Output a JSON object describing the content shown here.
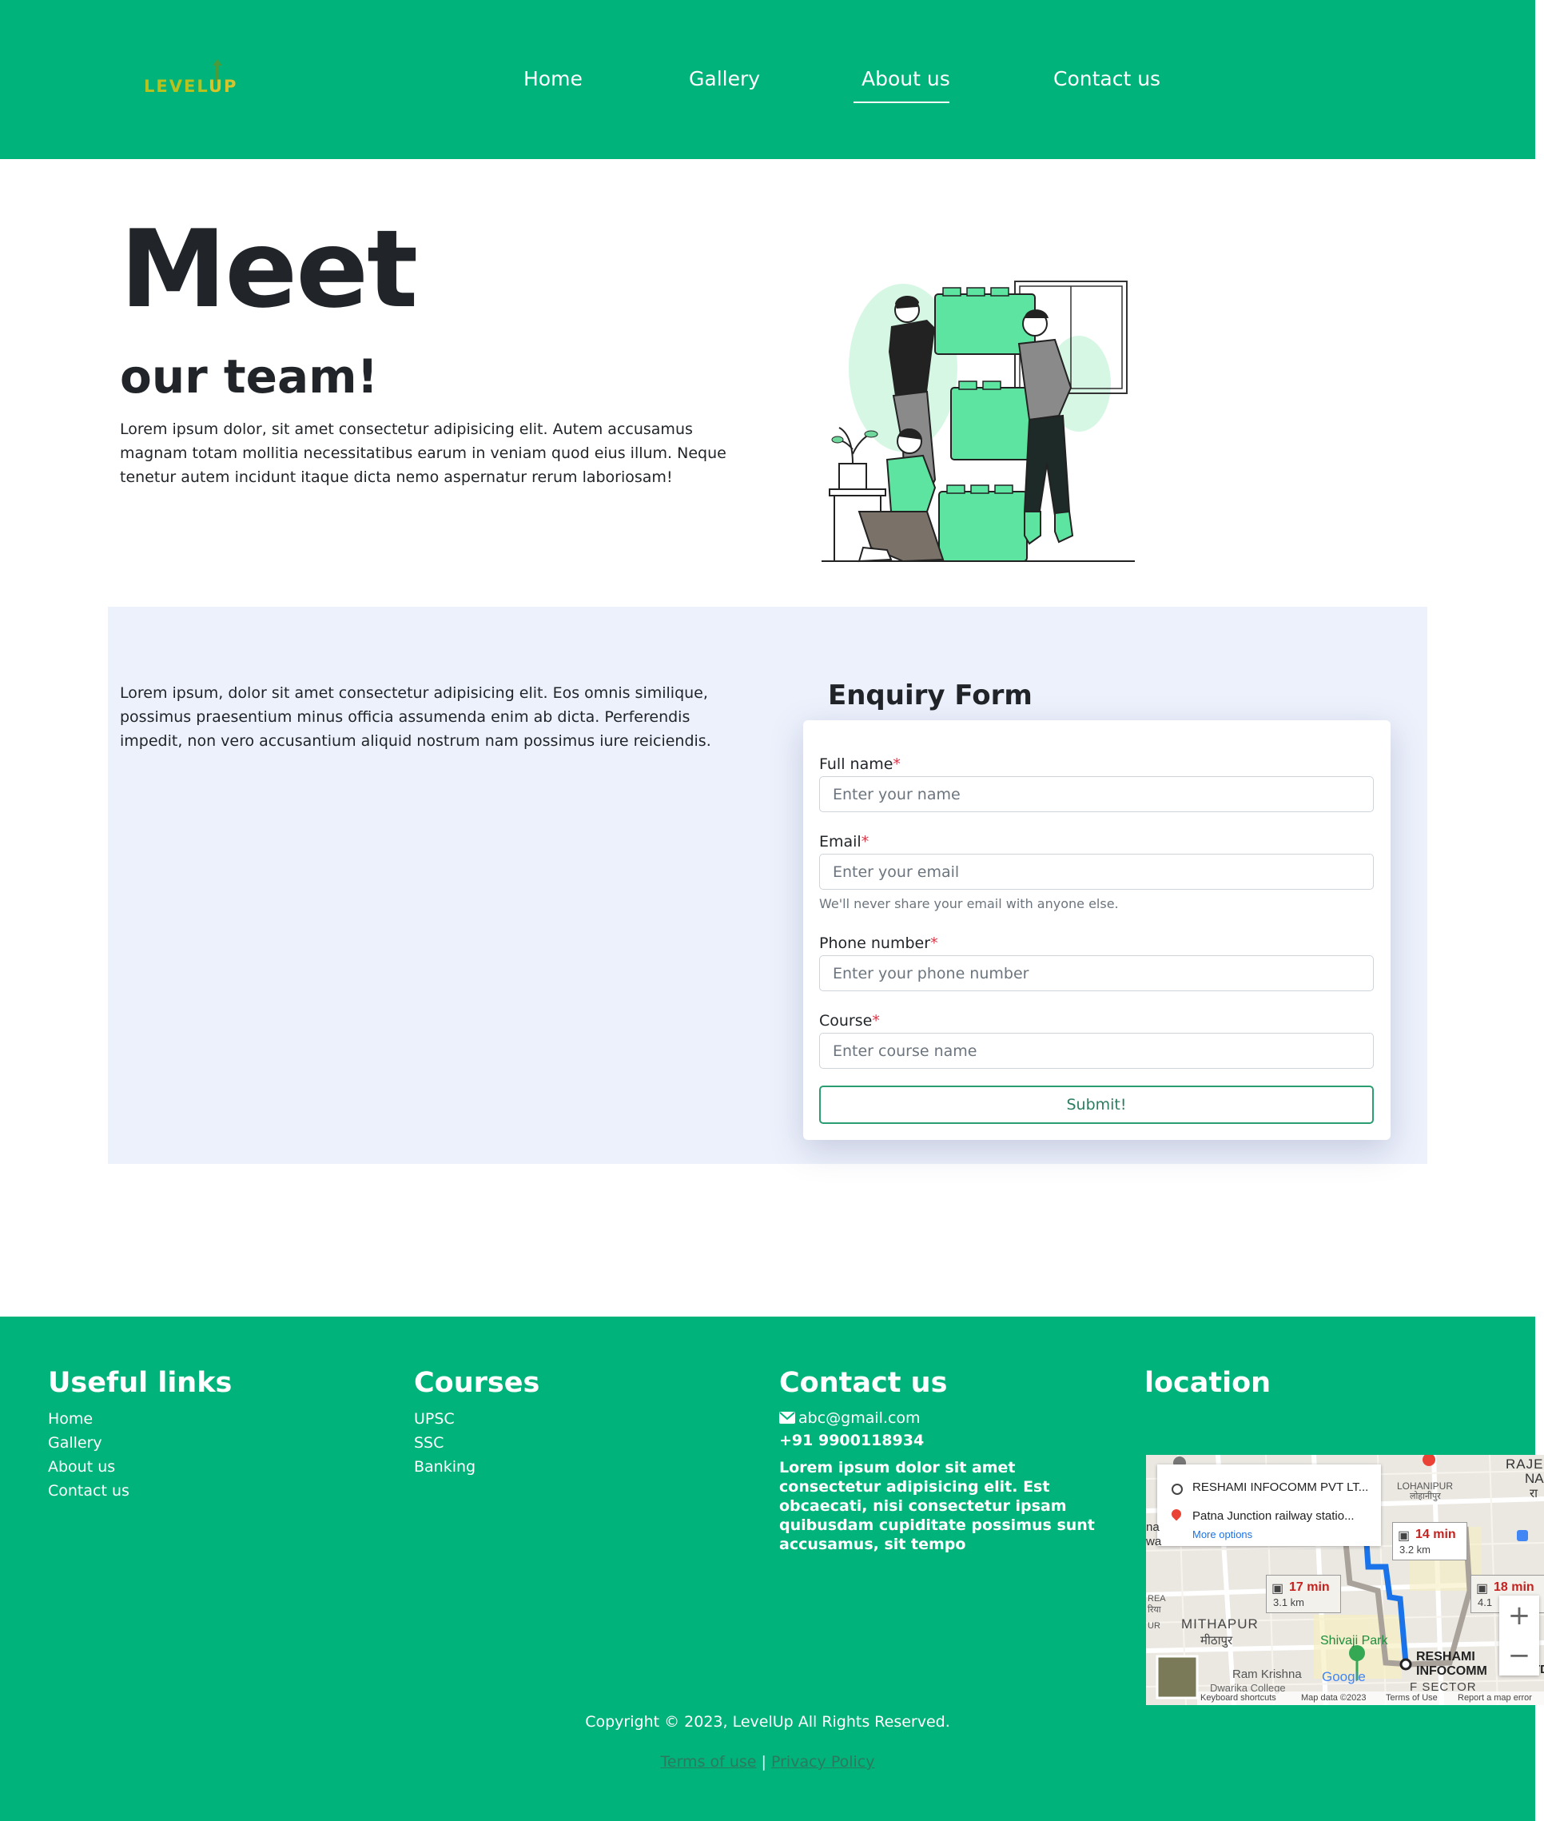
{
  "brand": {
    "logo_text_left": "LEVEL",
    "logo_text_right": "UP",
    "logo_color_level": "#b8c21f",
    "logo_color_up": "#d8c42a"
  },
  "nav": {
    "items": [
      {
        "label": "Home"
      },
      {
        "label": "Gallery"
      },
      {
        "label": "About us",
        "active": true
      },
      {
        "label": "Contact us"
      }
    ]
  },
  "hero": {
    "title": "Meet",
    "subtitle": "our team!",
    "text": "Lorem ipsum dolor, sit amet consectetur adipisicing elit. Autem accusamus magnam totam mollitia necessitatibus earum in veniam quod eius illum. Neque tenetur autem incidunt itaque dicta nemo aspernatur rerum laboriosam!",
    "illustration": "team-building-blocks-illustration"
  },
  "enquiry": {
    "text": "Lorem ipsum, dolor sit amet consectetur adipisicing elit. Eos omnis similique, possimus praesentium minus officia assumenda enim ab dicta. Perferendis impedit, non vero accusantium aliquid nostrum nam possimus iure reiciendis.",
    "form_title": "Enquiry Form",
    "required_mark": "*",
    "fields": {
      "name": {
        "label": "Full name",
        "placeholder": "Enter your name",
        "value": ""
      },
      "email": {
        "label": "Email",
        "placeholder": "Enter your email",
        "value": "",
        "help": "We'll never share your email with anyone else."
      },
      "phone": {
        "label": "Phone number",
        "placeholder": "Enter your phone number",
        "value": ""
      },
      "course": {
        "label": "Course",
        "placeholder": "Enter course name",
        "value": ""
      }
    },
    "submit_label": "Submit!"
  },
  "footer": {
    "useful_links": {
      "title": "Useful links",
      "items": [
        "Home",
        "Gallery",
        "About us",
        "Contact us"
      ]
    },
    "courses": {
      "title": "Courses",
      "items": [
        "UPSC",
        "SSC",
        "Banking"
      ]
    },
    "contact": {
      "title": "Contact us",
      "email": "abc@gmail.com",
      "phone": "+91 9900118934",
      "description": "Lorem ipsum dolor sit amet consectetur adipisicing elit. Est obcaecati, nisi consectetur ipsam quibusdam cupiditate possimus sunt accusamus, sit tempo"
    },
    "location": {
      "title": "location",
      "map": {
        "origin": "RESHAMI INFOCOMM PVT LT...",
        "destination": "Patna Junction railway statio...",
        "more_options": "More options",
        "routes": [
          {
            "time": "14 min",
            "distance": "3.2 km"
          },
          {
            "time": "17 min",
            "distance": "3.1 km"
          },
          {
            "time": "18 min",
            "distance": "4.1"
          }
        ],
        "places": {
          "lohanipur": "LOHANIPUR",
          "lohanipur_hi": "लोहानीपुर",
          "mithapur": "MITHAPUR",
          "mithapur_hi": "मीठापुर",
          "shivaji_park": "Shivaji Park",
          "reshami_1": "RESHAMI",
          "reshami_2": "INFOCOMM",
          "ram_krishna": "Ram Krishna",
          "dwarika": "Dwarika College",
          "f_sector": "F SECTOR",
          "raje": "RAJE",
          "na": "NA",
          "ra": "रा",
          "rea": "REA",
          "riya": "रिया",
          "ur": "UR",
          "na_left": "na",
          "wa_left": "wa",
          "td": "TD"
        },
        "zoom_in": "+",
        "zoom_out": "−",
        "google": "Google",
        "attribution": {
          "shortcuts": "Keyboard shortcuts",
          "data": "Map data ©2023",
          "terms": "Terms of Use",
          "report": "Report a map error"
        }
      }
    },
    "copyright": "Copyright © 2023, LevelUp All Rights Reserved.",
    "terms": "Terms of use",
    "separator": "|",
    "privacy": "Privacy Policy"
  },
  "colors": {
    "primary": "#00b37a",
    "section_bg": "#edf1fc",
    "required": "#dc3545",
    "text": "#212529"
  }
}
